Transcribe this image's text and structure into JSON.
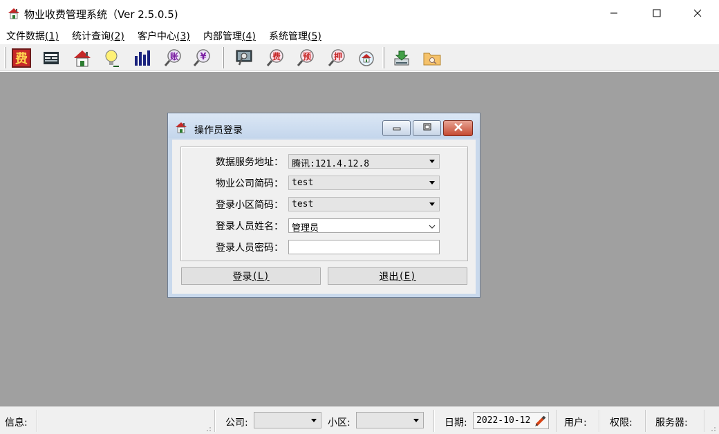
{
  "window": {
    "title": "物业收费管理系统（Ver 2.5.0.5)",
    "controls": [
      "minimize-icon",
      "maximize-icon",
      "close-icon"
    ]
  },
  "menu": [
    {
      "label": "文件数据",
      "key": "(1)"
    },
    {
      "label": "统计查询",
      "key": "(2)"
    },
    {
      "label": "客户中心",
      "key": "(3)"
    },
    {
      "label": "内部管理",
      "key": "(4)"
    },
    {
      "label": "系统管理",
      "key": "(5)"
    }
  ],
  "toolbar": {
    "buttons": [
      "fee-icon",
      "card-icon",
      "house-icon",
      "bulb-icon",
      "bar-chart-icon",
      "account-search-icon",
      "yuan-search-icon",
      "monitor-icon",
      "fee-search-icon",
      "prepay-search-icon",
      "deposit-search-icon",
      "house-search-icon",
      "download-icon",
      "folder-icon"
    ],
    "glyphs": {
      "fee": "费",
      "account": "账",
      "yuan": "¥",
      "fee2": "费",
      "prepay": "预",
      "deposit": "押"
    }
  },
  "dialog": {
    "title": "操作员登录",
    "fields": [
      {
        "label": "数据服务地址：",
        "value": "腾讯:121.4.12.8"
      },
      {
        "label": "物业公司简码：",
        "value": "test"
      },
      {
        "label": "登录小区简码：",
        "value": "test"
      },
      {
        "label": "登录人员姓名：",
        "value": "管理员"
      },
      {
        "label": "登录人员密码：",
        "value": ""
      }
    ],
    "login_button": {
      "label": "登录",
      "key": "(L)"
    },
    "exit_button": {
      "label": "退出",
      "key": "(E)"
    }
  },
  "status": {
    "info_label": "信息:",
    "company_label": "公司:",
    "company_value": "",
    "district_label": "小区:",
    "district_value": "",
    "date_label": "日期:",
    "date_value": "2022-10-12",
    "user_label": "用户:",
    "permission_label": "权限:",
    "server_label": "服务器:"
  },
  "colors": {
    "workspace": "#a0a0a0",
    "dialog_frame": "#c9d9ec",
    "close_button": "#c54a32"
  }
}
